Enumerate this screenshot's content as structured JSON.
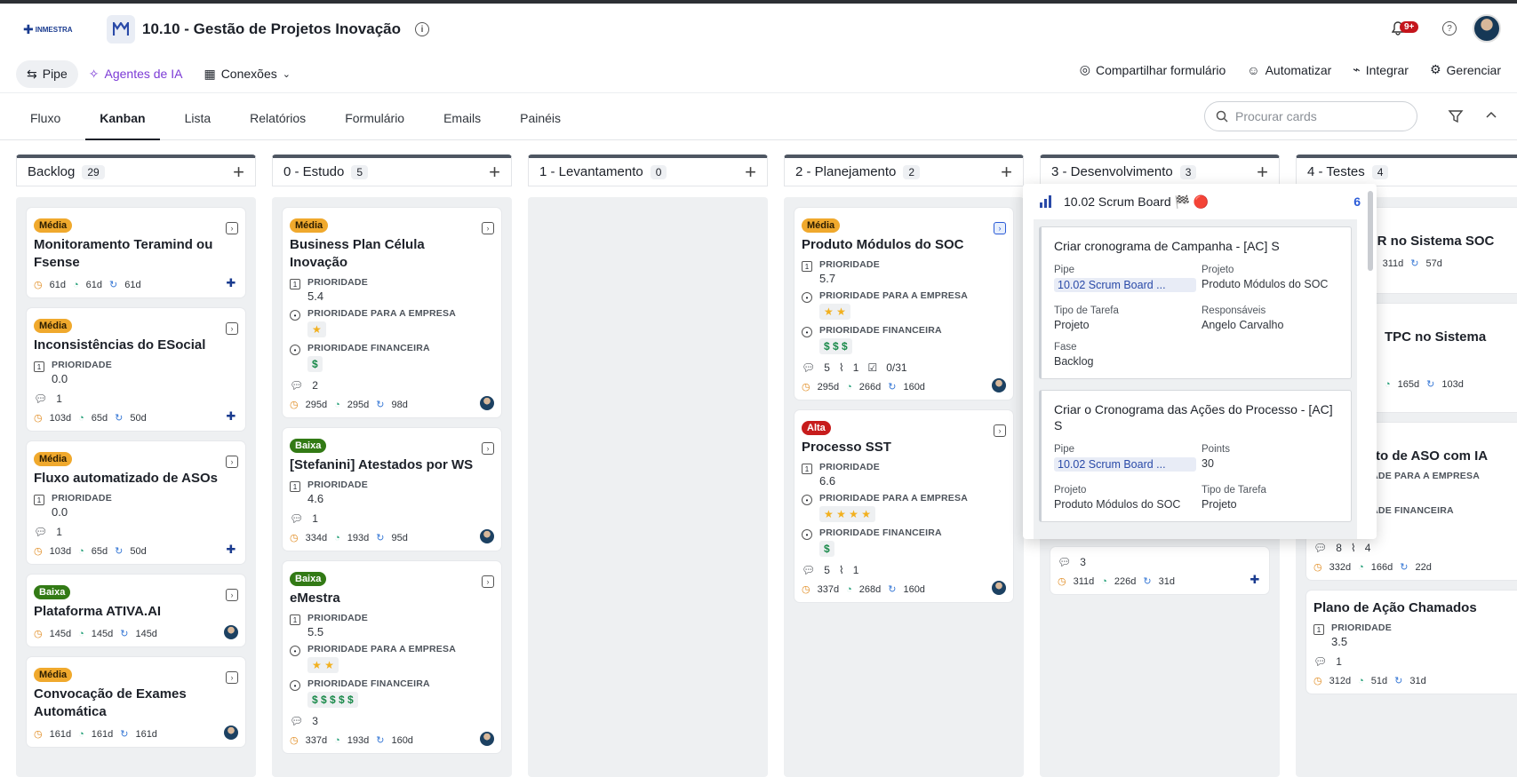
{
  "header": {
    "title": "10.10 - Gestão de Projetos Inovação",
    "notif_count": "9+",
    "logo_text": "INMESTRA"
  },
  "toolbar": {
    "pipe": "Pipe",
    "ai": "Agentes de IA",
    "connections": "Conexões",
    "share": "Compartilhar formulário",
    "automate": "Automatizar",
    "integrate": "Integrar",
    "manage": "Gerenciar"
  },
  "tabs": [
    "Fluxo",
    "Kanban",
    "Lista",
    "Relatórios",
    "Formulário",
    "Emails",
    "Painéis"
  ],
  "search": {
    "placeholder": "Procurar cards"
  },
  "labels": {
    "prioridade": "PRIORIDADE",
    "prio_empresa": "PRIORIDADE PARA A EMPRESA",
    "prio_fin": "PRIORIDADE FINANCEIRA"
  },
  "columns": [
    {
      "name": "Backlog",
      "count": "29",
      "cards": [
        {
          "prio": "Média",
          "title": "Monitoramento Teramind ou Fsense",
          "dates": [
            "61d",
            "61d",
            "61d"
          ]
        },
        {
          "prio": "Média",
          "title": "Inconsistências do ESocial",
          "prioridade": "0.0",
          "comments": "1",
          "dates": [
            "103d",
            "65d",
            "50d"
          ]
        },
        {
          "prio": "Média",
          "title": "Fluxo automatizado de ASOs",
          "prioridade": "0.0",
          "comments": "1",
          "dates": [
            "103d",
            "65d",
            "50d"
          ]
        },
        {
          "prio": "Baixa",
          "title": "Plataforma ATIVA.AI",
          "dates": [
            "145d",
            "145d",
            "145d"
          ]
        },
        {
          "prio": "Média",
          "title": "Convocação de Exames Automática",
          "dates": [
            "161d",
            "161d",
            "161d"
          ]
        }
      ]
    },
    {
      "name": "0 - Estudo",
      "count": "5",
      "cards": [
        {
          "prio": "Média",
          "title": "Business Plan Célula Inovação",
          "prioridade": "5.4",
          "empresa": "★",
          "fin": "$",
          "comments": "2",
          "dates": [
            "295d",
            "295d",
            "98d"
          ]
        },
        {
          "prio": "Baixa",
          "title": "[Stefanini] Atestados por WS",
          "prioridade": "4.6",
          "comments": "1",
          "dates": [
            "334d",
            "193d",
            "95d"
          ]
        },
        {
          "prio": "Baixa",
          "title": "eMestra",
          "prioridade": "5.5",
          "empresa": "★ ★",
          "fin": "$ $ $ $ $",
          "comments": "3",
          "dates": [
            "337d",
            "193d",
            "160d"
          ]
        }
      ]
    },
    {
      "name": "1 - Levantamento",
      "count": "0",
      "cards": []
    },
    {
      "name": "2 - Planejamento",
      "count": "2",
      "cards": [
        {
          "prio": "Média",
          "title": "Produto Módulos do SOC",
          "prioridade": "5.7",
          "empresa": "★ ★",
          "fin": "$ $ $",
          "comments": "5",
          "attach": "1",
          "checklist": "0/31",
          "dates": [
            "295d",
            "266d",
            "160d"
          ]
        },
        {
          "prio": "Alta",
          "title": "Processo SST",
          "prioridade": "6.6",
          "empresa": "★ ★ ★ ★",
          "fin": "$",
          "comments": "5",
          "attach": "1",
          "dates": [
            "337d",
            "268d",
            "160d"
          ]
        }
      ]
    },
    {
      "name": "3 - Desenvolvimento",
      "count": "3",
      "cards": [
        {
          "comments": "3",
          "dates": [
            "311d",
            "226d",
            "31d"
          ]
        }
      ]
    },
    {
      "name": "4 - Testes",
      "count": "4",
      "cards": [
        {
          "title": "GR no Sistema SOC",
          "dates": [
            "311d",
            "57d"
          ]
        },
        {
          "title": "TPC no Sistema",
          "dates": [
            "165d",
            "103d"
          ]
        },
        {
          "title": "to de ASO com IA",
          "empresa": "★ ★ ★",
          "fin": "$ $",
          "comments": "8",
          "attach": "4",
          "dates": [
            "332d",
            "166d",
            "22d"
          ]
        },
        {
          "title": "Plano de Ação Chamados",
          "prioridade": "3.5",
          "comments": "1",
          "dates": [
            "312d",
            "51d",
            "31d"
          ]
        }
      ]
    }
  ],
  "popover": {
    "title": "10.02 Scrum Board 🏁 🔴",
    "count": "6",
    "cards": [
      {
        "title": "Criar cronograma de Campanha - [AC] S",
        "pipe_label": "Pipe",
        "pipe": "10.02 Scrum Board ...",
        "proj_label": "Projeto",
        "proj": "Produto Módulos do SOC",
        "tipo_label": "Tipo de Tarefa",
        "tipo": "Projeto",
        "resp_label": "Responsáveis",
        "resp": "Angelo Carvalho",
        "fase_label": "Fase",
        "fase": "Backlog"
      },
      {
        "title": "Criar o Cronograma das Ações do Processo - [AC] S",
        "pipe_label": "Pipe",
        "pipe": "10.02 Scrum Board ...",
        "points_label": "Points",
        "points": "30",
        "proj_label": "Projeto",
        "proj": "Produto Módulos do SOC",
        "tipo_label": "Tipo de Tarefa",
        "tipo": "Projeto"
      }
    ]
  },
  "colors": {
    "accent": "#2a5bd7",
    "ai": "#7c3bd6",
    "media": "#f0a92d",
    "baixa": "#327a15",
    "alta": "#c71c1c"
  }
}
